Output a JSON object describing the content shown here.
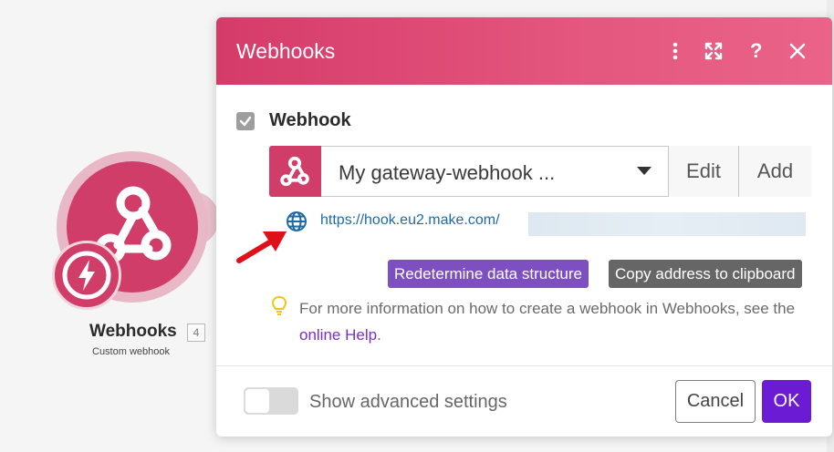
{
  "canvas": {
    "module": {
      "name": "Webhooks",
      "count": "4",
      "subtitle": "Custom webhook",
      "icon": "webhook-icon",
      "badge_icon": "lightning-icon",
      "color": "#d03d69"
    }
  },
  "dialog": {
    "title": "Webhooks",
    "header_buttons": {
      "more": "more-vertical-icon",
      "expand": "expand-icon",
      "help": "?",
      "close": "close-icon"
    },
    "field": {
      "label": "Webhook",
      "selected_value": "My gateway-webhook ...",
      "edit_label": "Edit",
      "add_label": "Add"
    },
    "url": {
      "text": "https://hook.eu2.make.com/",
      "icon": "globe-icon"
    },
    "actions": {
      "redetermine_label": "Redetermine data structure",
      "copy_label": "Copy address to clipboard"
    },
    "info": {
      "text_before": "For more information on how to create a webhook in Webhooks, see the ",
      "link": "online Help",
      "text_after": "."
    },
    "footer": {
      "advanced_label": "Show advanced settings",
      "advanced_on": false,
      "cancel_label": "Cancel",
      "ok_label": "OK"
    }
  },
  "colors": {
    "header": "#d53b69",
    "primary": "#6c1bd4",
    "redetermine": "#7d4fc0",
    "copy": "#666666",
    "link": "#1f6aa5",
    "arrow": "#e0101a"
  }
}
